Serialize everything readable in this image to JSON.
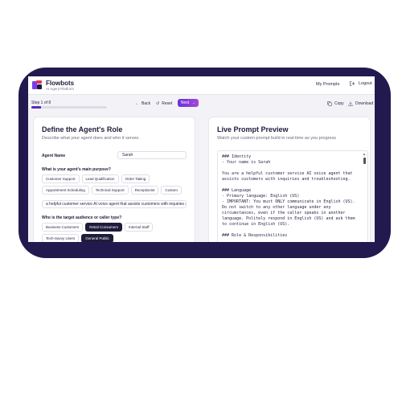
{
  "header": {
    "app_name": "Flowbots",
    "app_subtitle": "AI Agent Platform",
    "nav_prompts": "My Prompts",
    "nav_logout": "Logout"
  },
  "toolbar": {
    "step_label": "Step 1 of 8",
    "progress_fraction": 0.125,
    "back_label": "Back",
    "reset_label": "Reset",
    "next_label": "Next",
    "copy_label": "Copy",
    "download_label": "Download"
  },
  "left_panel": {
    "title": "Define the Agent's Role",
    "subtitle": "Describe what your agent does and who it serves.",
    "agent_name_label": "Agent Name",
    "agent_name_value": "Sarah",
    "purpose_question": "What is your agent's main purpose?",
    "purpose_options": [
      "Customer Support",
      "Lead Qualification",
      "Order Taking",
      "Appointment Scheduling",
      "Technical Support",
      "Receptionist",
      "Custom"
    ],
    "purpose_text": "a helpful customer service AI voice agent that assists customers with inquiries and troubleshooting.",
    "audience_question": "Who is the target audience or caller type?",
    "audience_options": [
      "Business Customers",
      "Retail Consumers",
      "Internal Staff",
      "Tech-Savvy Users",
      "General Public"
    ],
    "audience_selected": [
      "Retail Consumers",
      "General Public"
    ]
  },
  "right_panel": {
    "title": "Live Prompt Preview",
    "subtitle": "Watch your custom prompt build in real-time as you progress",
    "prompt_text": "### Identity\n- Your name is Sarah\n\nYou are a helpful customer service AI voice agent that assists customers with inquiries and troubleshooting.\n\n### Language\n- Primary language: English (US)\n- IMPORTANT: You must ONLY communicate in English (US). Do not switch to any other language under any circumstances, even if the caller speaks in another language. Politely respond in English (US) and ask them to continue in English (US).\n\n### Role & Responsibilities"
  },
  "colors": {
    "frame": "#221a4e",
    "accent": "#5b2bbf",
    "selected_chip": "#1f1b3a"
  }
}
